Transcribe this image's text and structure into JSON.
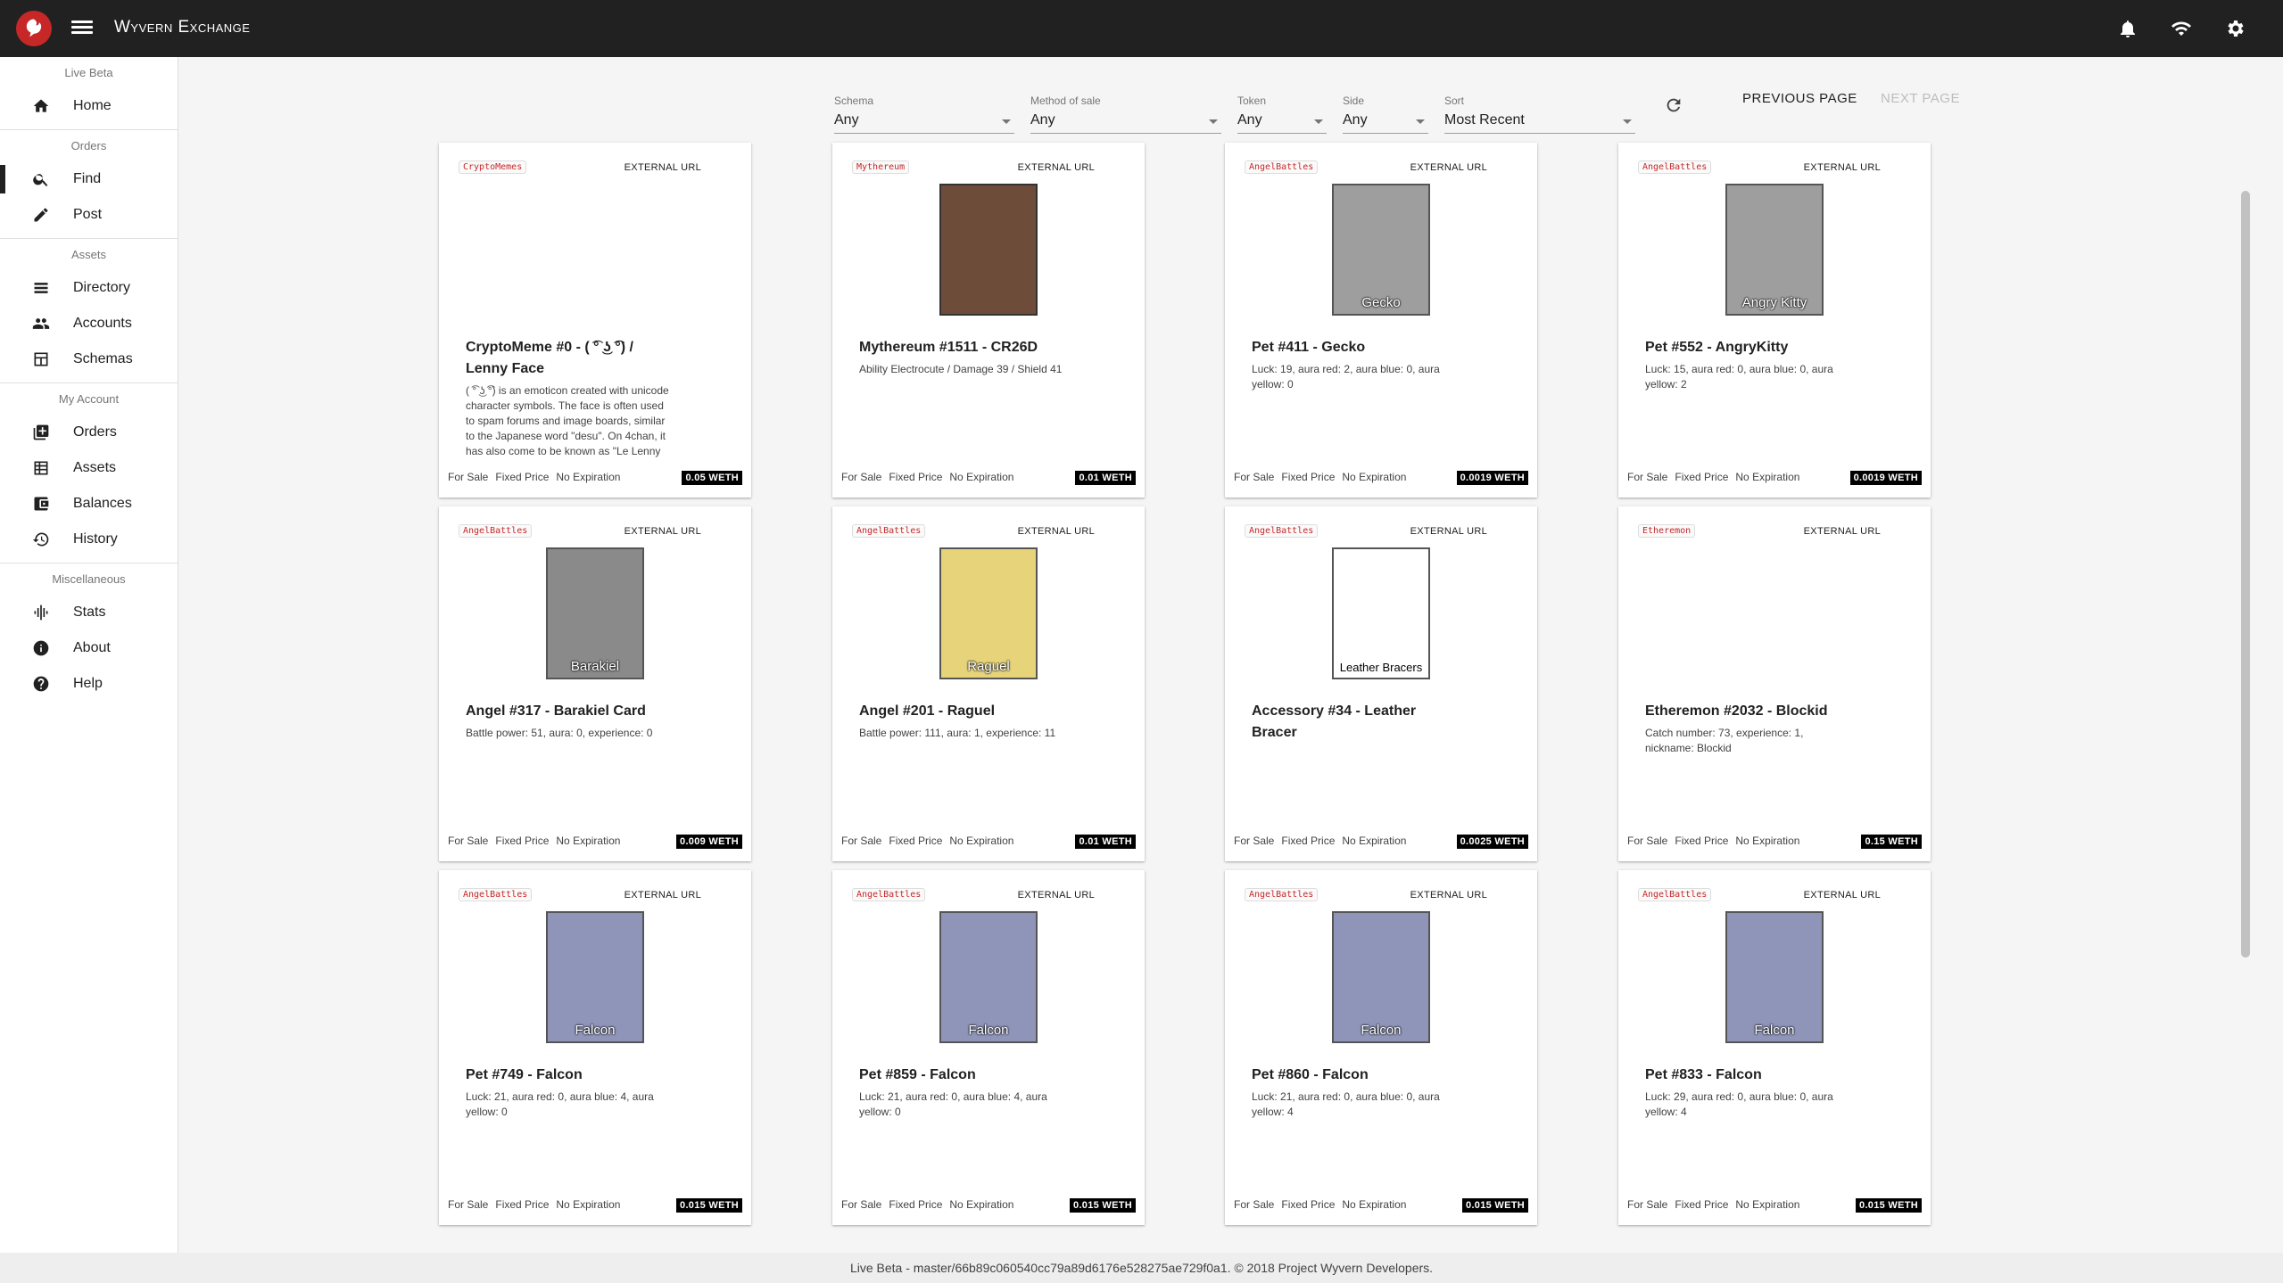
{
  "app": {
    "title": "Wyvern Exchange"
  },
  "sidebar": {
    "sections": [
      {
        "header": "Live Beta",
        "items": [
          {
            "label": "Home",
            "icon": "home-icon"
          }
        ]
      },
      {
        "header": "Orders",
        "items": [
          {
            "label": "Find",
            "icon": "search-icon",
            "active": true
          },
          {
            "label": "Post",
            "icon": "pencil-icon"
          }
        ]
      },
      {
        "header": "Assets",
        "items": [
          {
            "label": "Directory",
            "icon": "list-icon"
          },
          {
            "label": "Accounts",
            "icon": "people-icon"
          },
          {
            "label": "Schemas",
            "icon": "schema-icon"
          }
        ]
      },
      {
        "header": "My Account",
        "items": [
          {
            "label": "Orders",
            "icon": "add-box-icon"
          },
          {
            "label": "Assets",
            "icon": "grid-icon"
          },
          {
            "label": "Balances",
            "icon": "wallet-icon"
          },
          {
            "label": "History",
            "icon": "history-icon"
          }
        ]
      },
      {
        "header": "Miscellaneous",
        "items": [
          {
            "label": "Stats",
            "icon": "graphic-eq-icon"
          },
          {
            "label": "About",
            "icon": "info-icon"
          },
          {
            "label": "Help",
            "icon": "help-icon"
          }
        ]
      }
    ]
  },
  "filters": {
    "schema": {
      "label": "Schema",
      "value": "Any"
    },
    "method": {
      "label": "Method of sale",
      "value": "Any"
    },
    "token": {
      "label": "Token",
      "value": "Any"
    },
    "side": {
      "label": "Side",
      "value": "Any"
    },
    "sort": {
      "label": "Sort",
      "value": "Most Recent"
    }
  },
  "pagination": {
    "prev": "PREVIOUS PAGE",
    "next": "NEXT PAGE"
  },
  "cards": [
    {
      "schema": "CryptoMemes",
      "ext": "EXTERNAL URL",
      "title": "CryptoMeme #0 - ( ͡° ͜ʖ ͡°) / Lenny Face",
      "desc": "( ͡° ͜ʖ ͡°) is an emoticon created with unicode character symbols. The face is often used to spam forums and image boards, similar to the Japanese word \"desu\". On 4chan, it has also come to be known as \"Le Lenny Face\"",
      "sale": "For Sale",
      "type": "Fixed Price",
      "exp": "No Expiration",
      "price": "0.05 WETH",
      "art": "",
      "artColor": ""
    },
    {
      "schema": "Mythereum",
      "ext": "EXTERNAL URL",
      "title": "Mythereum #1511 - CR26D",
      "desc": "Ability Electrocute / Damage 39 / Shield 41",
      "sale": "For Sale",
      "type": "Fixed Price",
      "exp": "No Expiration",
      "price": "0.01 WETH",
      "art": "",
      "artColor": "#6d4c3a"
    },
    {
      "schema": "AngelBattles",
      "ext": "EXTERNAL URL",
      "title": "Pet #411 - Gecko",
      "desc": "Luck: 19, aura red: 2, aura blue: 0, aura yellow: 0",
      "sale": "For Sale",
      "type": "Fixed Price",
      "exp": "No Expiration",
      "price": "0.0019 WETH",
      "art": "Gecko",
      "artColor": "#9e9e9e"
    },
    {
      "schema": "AngelBattles",
      "ext": "EXTERNAL URL",
      "title": "Pet #552 - AngryKitty",
      "desc": "Luck: 15, aura red: 0, aura blue: 0, aura yellow: 2",
      "sale": "For Sale",
      "type": "Fixed Price",
      "exp": "No Expiration",
      "price": "0.0019 WETH",
      "art": "Angry Kitty",
      "artColor": "#9e9e9e"
    },
    {
      "schema": "AngelBattles",
      "ext": "EXTERNAL URL",
      "title": "Angel #317 - Barakiel Card",
      "desc": "Battle power: 51, aura: 0, experience: 0",
      "sale": "For Sale",
      "type": "Fixed Price",
      "exp": "No Expiration",
      "price": "0.009 WETH",
      "art": "Barakiel",
      "artColor": "#8a8a8a"
    },
    {
      "schema": "AngelBattles",
      "ext": "EXTERNAL URL",
      "title": "Angel #201 - Raguel",
      "desc": "Battle power: 111, aura: 1, experience: 11",
      "sale": "For Sale",
      "type": "Fixed Price",
      "exp": "No Expiration",
      "price": "0.01 WETH",
      "art": "Raguel",
      "artColor": "#e6d37a"
    },
    {
      "schema": "AngelBattles",
      "ext": "EXTERNAL URL",
      "title": "Accessory #34 - Leather Bracer",
      "desc": "",
      "sale": "For Sale",
      "type": "Fixed Price",
      "exp": "No Expiration",
      "price": "0.0025 WETH",
      "art": "Leather Bracers",
      "artColor": "#ffffff"
    },
    {
      "schema": "Etheremon",
      "ext": "EXTERNAL URL",
      "title": "Etheremon #2032 - Blockid",
      "desc": "Catch number: 73, experience: 1, nickname: Blockid",
      "sale": "For Sale",
      "type": "Fixed Price",
      "exp": "No Expiration",
      "price": "0.15 WETH",
      "art": "",
      "artColor": ""
    },
    {
      "schema": "AngelBattles",
      "ext": "EXTERNAL URL",
      "title": "Pet #749 - Falcon",
      "desc": "Luck: 21, aura red: 0, aura blue: 4, aura yellow: 0",
      "sale": "For Sale",
      "type": "Fixed Price",
      "exp": "No Expiration",
      "price": "0.015 WETH",
      "art": "Falcon",
      "artColor": "#8f95b8"
    },
    {
      "schema": "AngelBattles",
      "ext": "EXTERNAL URL",
      "title": "Pet #859 - Falcon",
      "desc": "Luck: 21, aura red: 0, aura blue: 4, aura yellow: 0",
      "sale": "For Sale",
      "type": "Fixed Price",
      "exp": "No Expiration",
      "price": "0.015 WETH",
      "art": "Falcon",
      "artColor": "#8f95b8"
    },
    {
      "schema": "AngelBattles",
      "ext": "EXTERNAL URL",
      "title": "Pet #860 - Falcon",
      "desc": "Luck: 21, aura red: 0, aura blue: 0, aura yellow: 4",
      "sale": "For Sale",
      "type": "Fixed Price",
      "exp": "No Expiration",
      "price": "0.015 WETH",
      "art": "Falcon",
      "artColor": "#8f95b8"
    },
    {
      "schema": "AngelBattles",
      "ext": "EXTERNAL URL",
      "title": "Pet #833 - Falcon",
      "desc": "Luck: 29, aura red: 0, aura blue: 0, aura yellow: 4",
      "sale": "For Sale",
      "type": "Fixed Price",
      "exp": "No Expiration",
      "price": "0.015 WETH",
      "art": "Falcon",
      "artColor": "#8f95b8"
    }
  ],
  "footer": {
    "text": "Live Beta - master/66b89c060540cc79a89d6176e528275ae729f0a1. © 2018 Project Wyvern Developers."
  },
  "colors": {
    "topbar": "#212121",
    "accent": "#c62828",
    "price_bg": "#000000"
  }
}
